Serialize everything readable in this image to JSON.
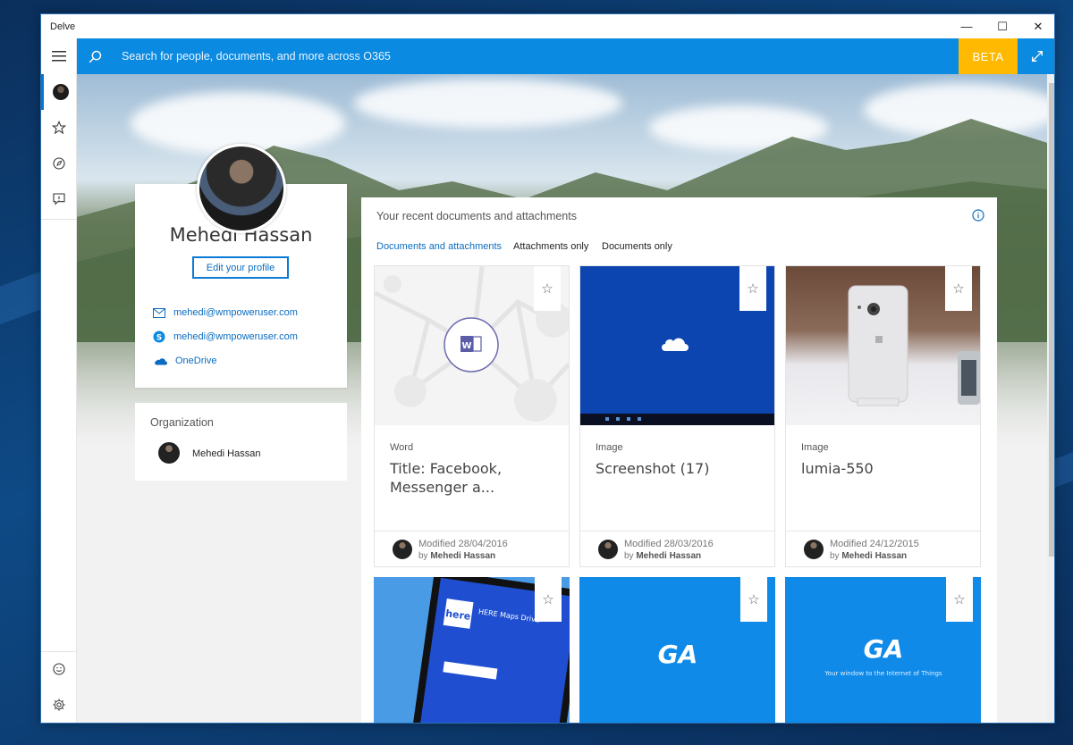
{
  "window": {
    "title": "Delve",
    "controls": {
      "minimize": "—",
      "maximize": "☐",
      "close": "✕"
    }
  },
  "search": {
    "placeholder": "Search for people, documents, and more across O365",
    "beta_label": "BETA"
  },
  "rail": {
    "items": [
      "menu-icon",
      "profile",
      "star-icon",
      "compass-icon",
      "feedback-icon"
    ],
    "bottom": [
      "smiley-icon",
      "gear-icon"
    ]
  },
  "profile": {
    "name": "Mehedi Hassan",
    "edit_label": "Edit your profile",
    "contacts": [
      {
        "icon": "mail-icon",
        "text": "mehedi@wmpoweruser.com"
      },
      {
        "icon": "skype-icon",
        "text": "mehedi@wmpoweruser.com"
      },
      {
        "icon": "onedrive-icon",
        "text": "OneDrive"
      }
    ]
  },
  "organization": {
    "title": "Organization",
    "member": "Mehedi Hassan"
  },
  "documents": {
    "title": "Your recent documents and attachments",
    "filters": [
      "Documents and attachments",
      "Attachments only",
      "Documents only"
    ],
    "active_filter": 0,
    "tiles": [
      {
        "type": "Word",
        "title": "Title: Facebook, Messenger a...",
        "modified": "Modified 28/04/2016",
        "by_prefix": "by",
        "author": "Mehedi Hassan"
      },
      {
        "type": "Image",
        "title": "Screenshot (17)",
        "modified": "Modified 28/03/2016",
        "by_prefix": "by",
        "author": "Mehedi Hassan"
      },
      {
        "type": "Image",
        "title": "lumia-550",
        "modified": "Modified 24/12/2015",
        "by_prefix": "by",
        "author": "Mehedi Hassan"
      }
    ],
    "second_row": {
      "here_app_name": "HERE Maps Drive",
      "ga_tagline": "Your window to the Internet of Things"
    }
  },
  "colors": {
    "accent": "#0a8ae0",
    "beta": "#ffb900",
    "link": "#0a6cc0",
    "tile_blue": "#0f8ae8"
  }
}
